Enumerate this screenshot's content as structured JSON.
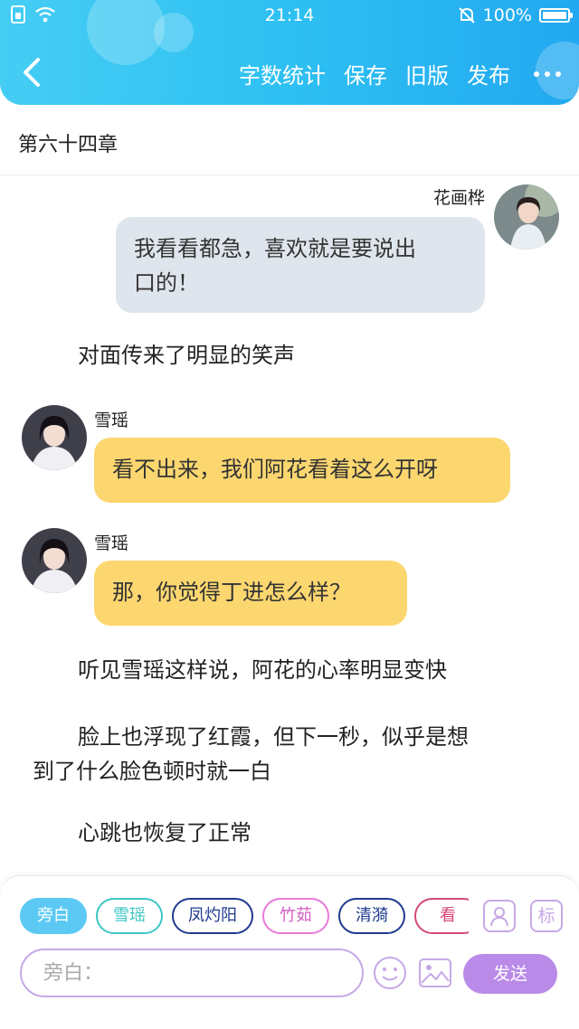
{
  "status_bar": {
    "time": "21:14",
    "battery": "100%"
  },
  "toolbar": {
    "word_count": "字数统计",
    "save": "保存",
    "old_version": "旧版",
    "publish": "发布"
  },
  "chapter": {
    "title": "第六十四章"
  },
  "messages": [
    {
      "type": "dialog",
      "side": "right",
      "name": "花画桦",
      "text_line1": "我看看都急，喜欢就是要说出",
      "text_line2": "口的！"
    },
    {
      "type": "narration",
      "text": "对面传来了明显的笑声"
    },
    {
      "type": "dialog",
      "side": "left",
      "name": "雪瑶",
      "text": "看不出来，我们阿花看着这么开呀"
    },
    {
      "type": "dialog",
      "side": "left",
      "name": "雪瑶",
      "text": "那，你觉得丁进怎么样？"
    },
    {
      "type": "narration",
      "text": "听见雪瑶这样说，阿花的心率明显变快"
    },
    {
      "type": "narration",
      "text_line1": "脸上也浮现了红霞，但下一秒，似乎是想",
      "text_line2": "到了什么脸色顿时就一白"
    },
    {
      "type": "narration",
      "text": "心跳也恢复了正常"
    }
  ],
  "roles": [
    "旁白",
    "雪瑶",
    "凤灼阳",
    "竹茹",
    "清漪",
    "看"
  ],
  "role_icon_label": "标",
  "input": {
    "placeholder": "旁白："
  },
  "send_label": "发送",
  "colors": {
    "header": "#2ec0f2",
    "bubble_gray": "#dfe5ec",
    "bubble_yellow": "#fcd770",
    "send": "#b98ae8"
  }
}
